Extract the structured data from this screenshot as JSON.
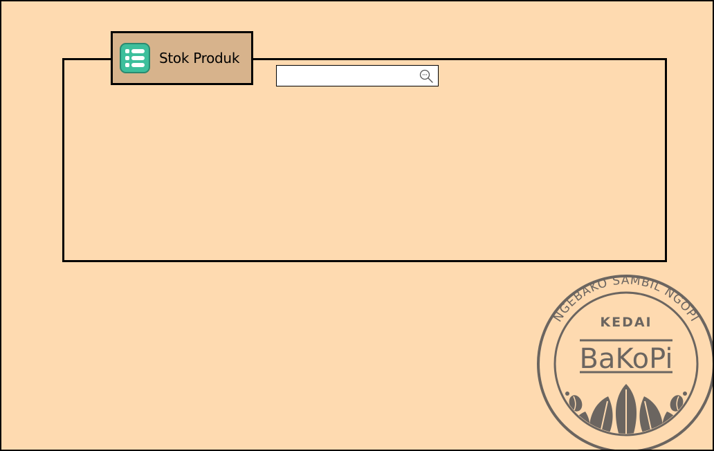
{
  "colors": {
    "background": "#fedab0",
    "tab": "#d7b38c",
    "icon_tile": "#3dbf9c",
    "stamp": "#6b6560"
  },
  "window": {
    "title": "Stok Produk",
    "title_icon": "list-icon"
  },
  "search": {
    "value": "",
    "placeholder": "",
    "icon": "search-icon"
  },
  "logo": {
    "ring_text": "NGEBAKO SAMBIL NGOPI",
    "top_text": "KEDAI",
    "brand_text": "BaKoPi"
  }
}
